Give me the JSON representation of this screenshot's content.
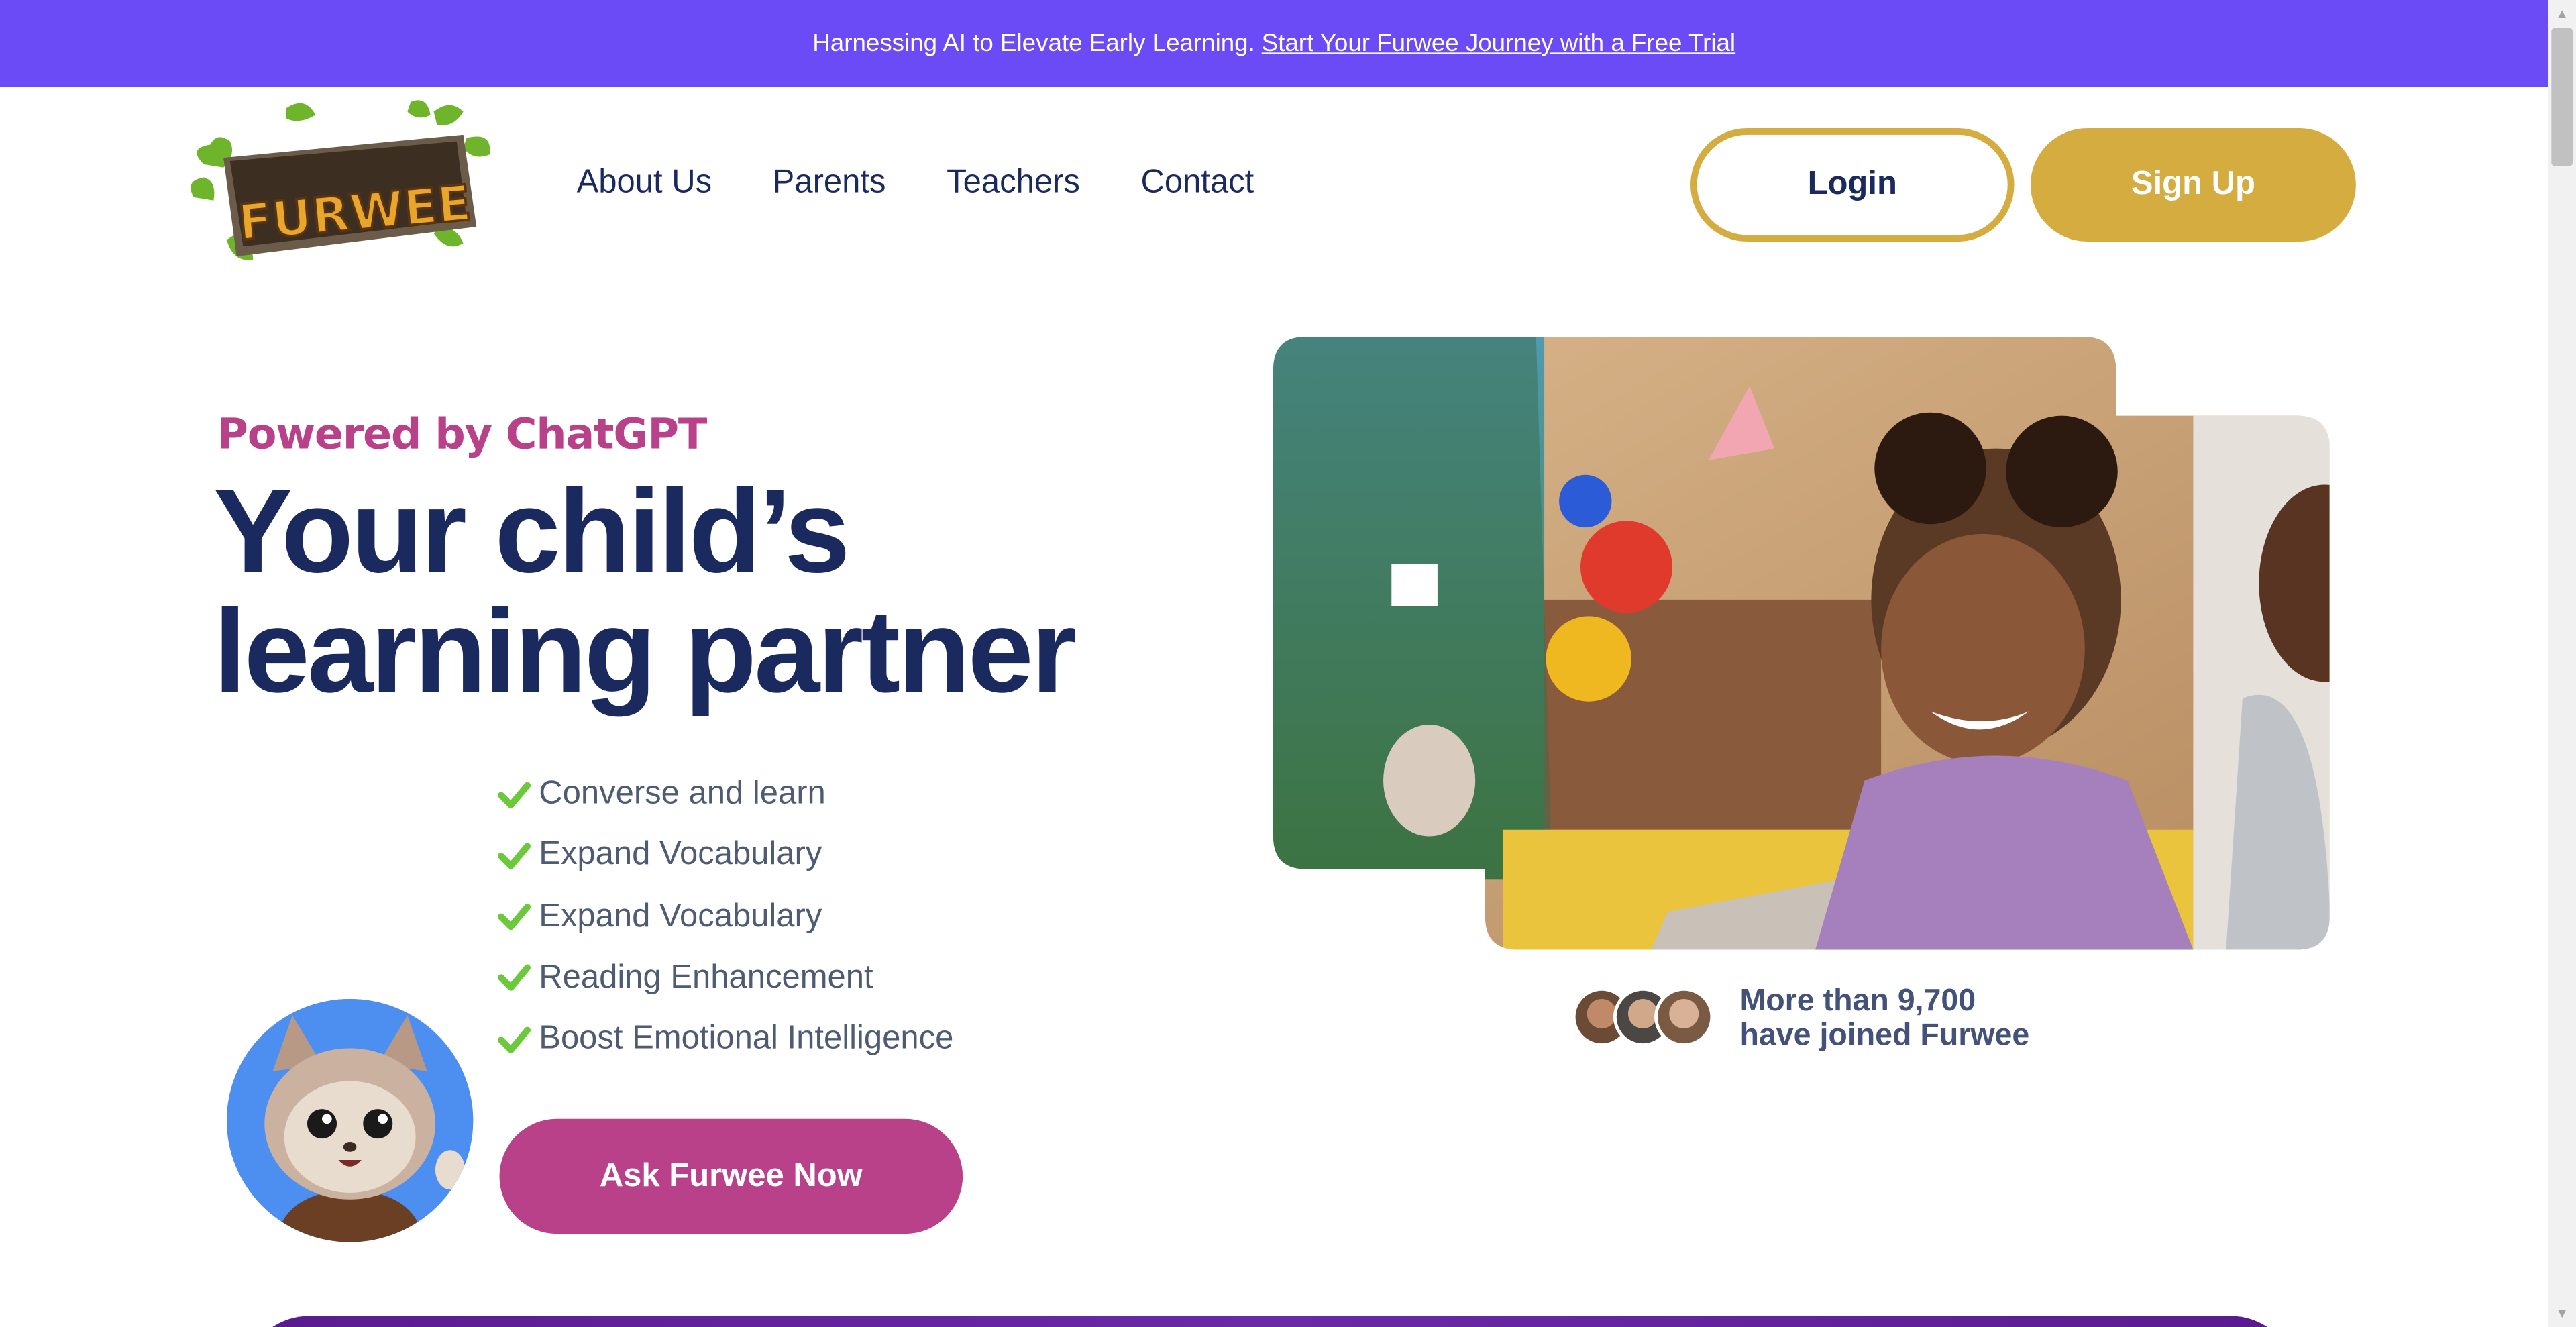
{
  "announcement": {
    "text": "Harnessing AI to Elevate Early Learning.",
    "link": "Start Your Furwee Journey with a Free Trial"
  },
  "brand": {
    "logo_text": "FURWEE",
    "colors": {
      "purple": "#6a4bf5",
      "gold": "#d4ac3f",
      "magenta": "#b8418a",
      "navy": "#1b2a5e"
    }
  },
  "nav": {
    "items": [
      "About Us",
      "Parents",
      "Teachers",
      "Contact"
    ],
    "login_label": "Login",
    "signup_label": "Sign Up"
  },
  "hero": {
    "eyebrow": "Powered by ChatGPT",
    "headline_line1": "Your child’s",
    "headline_line2": "learning partner",
    "features": [
      "Converse and learn",
      "Expand Vocabulary",
      "Expand Vocabulary",
      "Reading Enhancement",
      "Boost Emotional Intelligence"
    ],
    "feature_icon": "checkmark-icon",
    "cta_label": "Ask Furwee Now"
  },
  "social_proof": {
    "line1": "More than 9,700",
    "line2": "have joined Furwee"
  }
}
